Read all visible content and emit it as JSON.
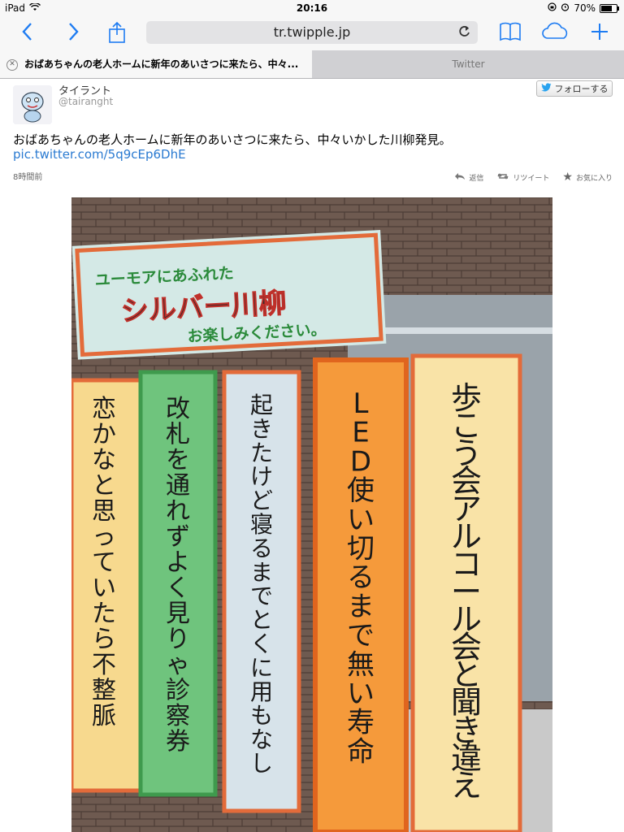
{
  "status": {
    "device": "iPad",
    "time": "20:16",
    "battery": "70%",
    "battery_level": 0.7
  },
  "browser": {
    "url": "tr.twipple.jp"
  },
  "tabs": [
    {
      "label": "おばあちゃんの老人ホームに新年のあいさつに来たら、中々..."
    },
    {
      "label": "Twitter"
    }
  ],
  "tweet": {
    "display_name": "タイラント",
    "screen_name": "@tairanght",
    "follow_label": "フォローする",
    "text": "おばあちゃんの老人ホームに新年のあいさつに来たら、中々いかした川柳発見。",
    "link": "pic.twitter.com/5q9cEp6DhE",
    "timestamp": "8時間前",
    "actions": {
      "reply": "返信",
      "retweet": "リツイート",
      "favorite": "お気に入り"
    }
  },
  "photo": {
    "header_line1": "ユーモアにあふれた",
    "header_line2": "シルバー川柳",
    "header_line3": "お楽しみください。",
    "strips": [
      {
        "text": "恋かなと思っていたら不整脈",
        "color": "#f7d98e"
      },
      {
        "text": "改札を通れずよく見りゃ診察券",
        "color": "#6fc47d"
      },
      {
        "text": "起きたけど寝るまでとくに用もなし",
        "color": "#d7e3ea"
      },
      {
        "text": "LED使い切るまで無い寿命",
        "color": "#f59a3b"
      },
      {
        "text": "歩こう会アルコール会と聞き違え",
        "color": "#f9e3a7"
      }
    ]
  }
}
